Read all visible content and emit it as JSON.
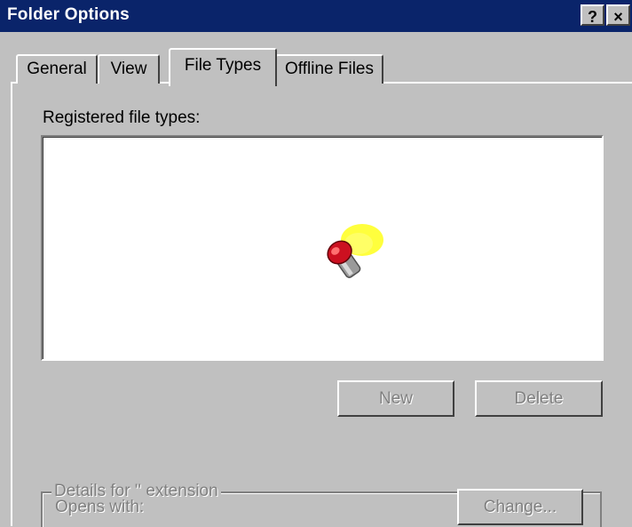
{
  "window": {
    "title": "Folder Options",
    "help_button": "?",
    "close_button": "×"
  },
  "tabs": [
    {
      "label": "General",
      "selected": false
    },
    {
      "label": "View",
      "selected": false
    },
    {
      "label": "File Types",
      "selected": true
    },
    {
      "label": "Offline Files",
      "selected": false
    }
  ],
  "file_types": {
    "label": "Registered file types:",
    "loading_animation": "flashlight-icon"
  },
  "buttons": {
    "new_label": "New",
    "delete_label": "Delete",
    "change_label": "Change..."
  },
  "details": {
    "group_title": "Details for '' extension",
    "opens_with_label": "Opens with:"
  },
  "colors": {
    "titlebar": "#0a246a",
    "face": "#c0c0c0",
    "disabled_text": "#808080"
  }
}
